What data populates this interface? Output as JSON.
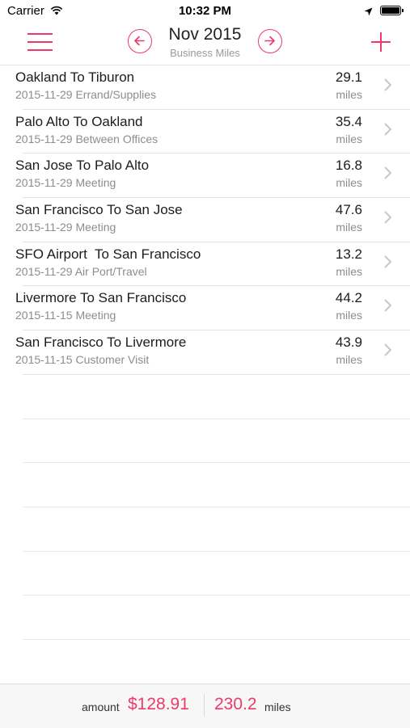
{
  "status_bar": {
    "carrier": "Carrier",
    "time": "10:32 PM",
    "icons": [
      "wifi-icon",
      "location-arrow-icon",
      "battery-icon"
    ]
  },
  "header": {
    "title": "Nov 2015",
    "subtitle": "Business Miles",
    "icons": [
      "menu-icon",
      "arrow-left-circle-icon",
      "arrow-right-circle-icon",
      "plus-icon"
    ]
  },
  "accent_color": "#f0386b",
  "trips": [
    {
      "route": "Oakland To Tiburon",
      "date": "2015-11-29",
      "purpose": "Errand/Supplies",
      "miles": "29.1",
      "unit": "miles"
    },
    {
      "route": "Palo Alto To Oakland",
      "date": "2015-11-29",
      "purpose": "Between Offices",
      "miles": "35.4",
      "unit": "miles"
    },
    {
      "route": "San Jose To Palo Alto",
      "date": "2015-11-29",
      "purpose": "Meeting",
      "miles": "16.8",
      "unit": "miles"
    },
    {
      "route": "San Francisco To San Jose",
      "date": "2015-11-29",
      "purpose": "Meeting",
      "miles": "47.6",
      "unit": "miles"
    },
    {
      "route": "SFO Airport  To San Francisco",
      "date": "2015-11-29",
      "purpose": "Air Port/Travel",
      "miles": "13.2",
      "unit": "miles"
    },
    {
      "route": "Livermore To San Francisco",
      "date": "2015-11-15",
      "purpose": "Meeting",
      "miles": "44.2",
      "unit": "miles"
    },
    {
      "route": "San Francisco To Livermore",
      "date": "2015-11-15",
      "purpose": "Customer Visit",
      "miles": "43.9",
      "unit": "miles"
    }
  ],
  "footer": {
    "amount_label": "amount",
    "amount_value": "$128.91",
    "miles_value": "230.2",
    "miles_label": "miles"
  }
}
